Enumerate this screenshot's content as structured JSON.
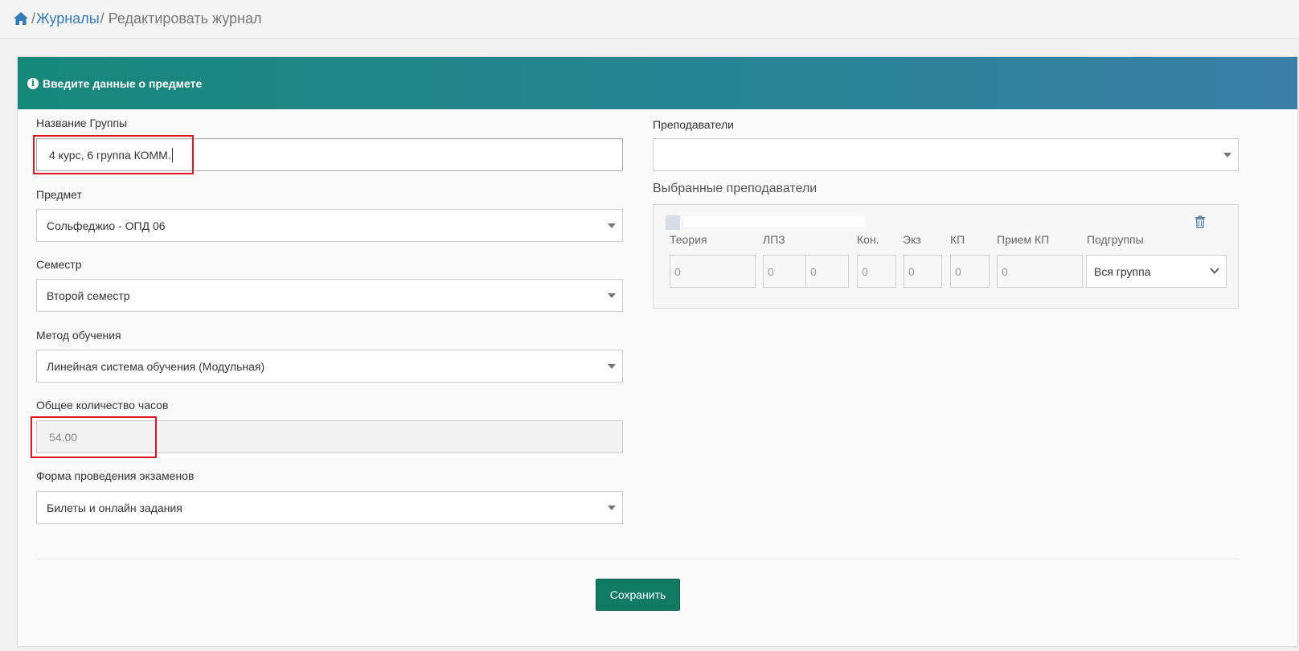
{
  "breadcrumb": {
    "journals": "Журналы",
    "current": "Редактировать журнал",
    "separator": "/"
  },
  "card": {
    "header": "Введите данные о предмете"
  },
  "form": {
    "group_name": {
      "label": "Название Группы",
      "value": "4 курс, 6 группа КОММ."
    },
    "subject": {
      "label": "Предмет",
      "value": "Сольфеджио - ОПД 06"
    },
    "semester": {
      "label": "Семестр",
      "value": "Второй семестр"
    },
    "method": {
      "label": "Метод обучения",
      "value": "Линейная система обучения (Модульная)"
    },
    "total_hours": {
      "label": "Общее количество часов",
      "value": "54.00"
    },
    "exam_form": {
      "label": "Форма проведения экзаменов",
      "value": "Билеты и онлайн задания"
    }
  },
  "teachers": {
    "label": "Преподаватели",
    "value": "",
    "selected_label": "Выбранные преподаватели",
    "columns": {
      "theory": "Теория",
      "lpz": "ЛПЗ",
      "kon": "Кон.",
      "exam": "Экз",
      "kp": "КП",
      "kp_reception": "Прием КП",
      "subgroups": "Подгруппы"
    },
    "values": {
      "theory": "0",
      "lpz_1": "0",
      "lpz_2": "0",
      "kon": "0",
      "exam": "0",
      "kp": "0",
      "kp_reception": "0",
      "subgroup": "Вся группа"
    }
  },
  "actions": {
    "save": "Сохранить"
  },
  "colors": {
    "accent": "#117a63",
    "link": "#337ab7",
    "highlight": "#e0141b"
  }
}
